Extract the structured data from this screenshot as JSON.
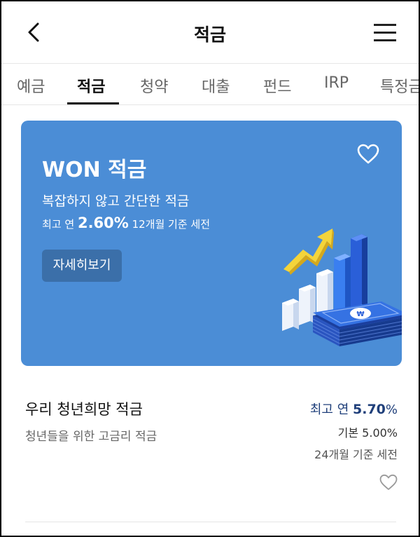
{
  "header": {
    "title": "적금",
    "back_icon": "chevron-left-icon",
    "menu_icon": "hamburger-menu-icon"
  },
  "tabs": [
    {
      "label": "예금",
      "active": false
    },
    {
      "label": "적금",
      "active": true
    },
    {
      "label": "청약",
      "active": false
    },
    {
      "label": "대출",
      "active": false
    },
    {
      "label": "펀드",
      "active": false
    },
    {
      "label": "IRP",
      "active": false
    },
    {
      "label": "특정금",
      "active": false
    }
  ],
  "banner": {
    "title": "WON 적금",
    "subtitle": "복잡하지 않고 간단한 적금",
    "rate_prefix": "최고 연",
    "rate": "2.60%",
    "rate_suffix": "12개월 기준 세전",
    "detail_button": "자세히보기",
    "background_color": "#4b8dd6",
    "button_color": "#3b6fa9"
  },
  "products": [
    {
      "name": "우리 청년희망 적금",
      "description": "청년들을 위한 고금리 적금",
      "max_rate_label": "최고 연",
      "max_rate_value": "5.70",
      "max_rate_unit": "%",
      "base_rate_label": "기본",
      "base_rate_value": "5.00",
      "base_rate_unit": "%",
      "term": "24개월 기준 세전",
      "rate_color": "#1f3f7a"
    }
  ]
}
